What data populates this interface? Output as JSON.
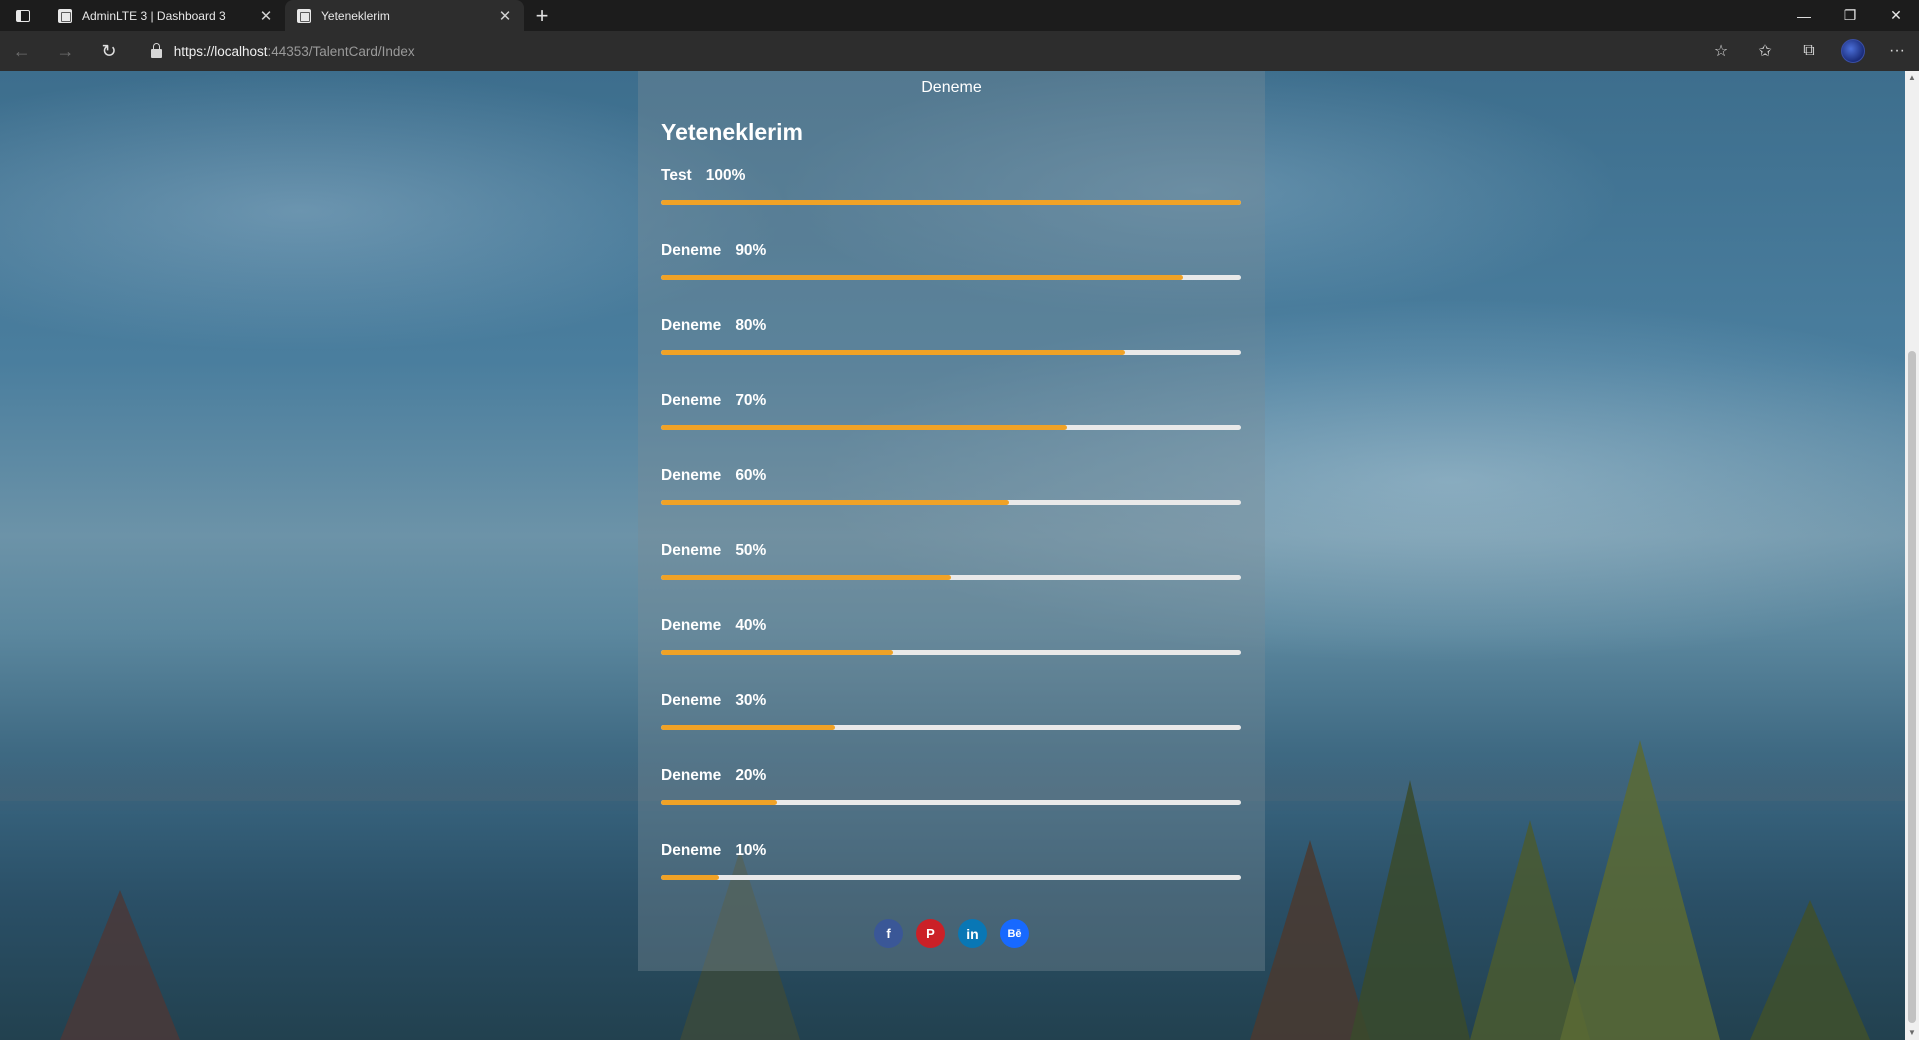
{
  "browser": {
    "tabs": [
      {
        "title": "AdminLTE 3 | Dashboard 3",
        "active": false
      },
      {
        "title": "Yeteneklerim",
        "active": true
      }
    ],
    "new_tab_icon": "+",
    "url_scheme_host": "https://localhost",
    "url_rest": ":44353/TalentCard/Index"
  },
  "page": {
    "card_name": "Deneme",
    "section_title": "Yeteneklerim",
    "skills": [
      {
        "name": "Test",
        "percent_label": "100%",
        "level": 1.0
      },
      {
        "name": "Deneme",
        "percent_label": "90%",
        "level": 0.9
      },
      {
        "name": "Deneme",
        "percent_label": "80%",
        "level": 0.8
      },
      {
        "name": "Deneme",
        "percent_label": "70%",
        "level": 0.7
      },
      {
        "name": "Deneme",
        "percent_label": "60%",
        "level": 0.6
      },
      {
        "name": "Deneme",
        "percent_label": "50%",
        "level": 0.5
      },
      {
        "name": "Deneme",
        "percent_label": "40%",
        "level": 0.4
      },
      {
        "name": "Deneme",
        "percent_label": "30%",
        "level": 0.3
      },
      {
        "name": "Deneme",
        "percent_label": "20%",
        "level": 0.2
      },
      {
        "name": "Deneme",
        "percent_label": "10%",
        "level": 0.1
      }
    ],
    "socials": [
      {
        "name": "facebook-icon",
        "glyph": "f",
        "color": "#3a5797"
      },
      {
        "name": "pinterest-icon",
        "glyph": "P",
        "color": "#cb2027"
      },
      {
        "name": "linkedin-icon",
        "glyph": "in",
        "color": "#0977b5"
      },
      {
        "name": "behance-icon",
        "glyph": "Bē",
        "color": "#1769ff"
      }
    ]
  },
  "colors": {
    "bar_fill": "#f0a226",
    "bar_track": "#e9e9e9"
  }
}
